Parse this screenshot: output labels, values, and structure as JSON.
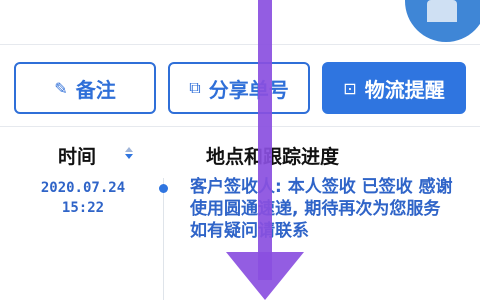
{
  "header": {
    "avatar_icon": "user-avatar-icon"
  },
  "actions": {
    "note_label": "备注",
    "note_icon": "edit-icon",
    "share_label": "分享单号",
    "share_icon": "share-icon",
    "remind_label": "物流提醒",
    "remind_icon": "bookmark-icon"
  },
  "table": {
    "col_time": "时间",
    "col_progress": "地点和跟踪进度",
    "sort_icon": "sort-icon"
  },
  "entries": [
    {
      "date": "2020.07.24",
      "time": "15:22",
      "status": "客户签收人: 本人签收 已签收 感谢使用圆通速递, 期待再次为您服务 如有疑问请联系"
    }
  ],
  "overlay": {
    "arrow_color": "#8a4fe0"
  },
  "colors": {
    "accent": "#2f75e0",
    "text_blue": "#2f64c8"
  }
}
